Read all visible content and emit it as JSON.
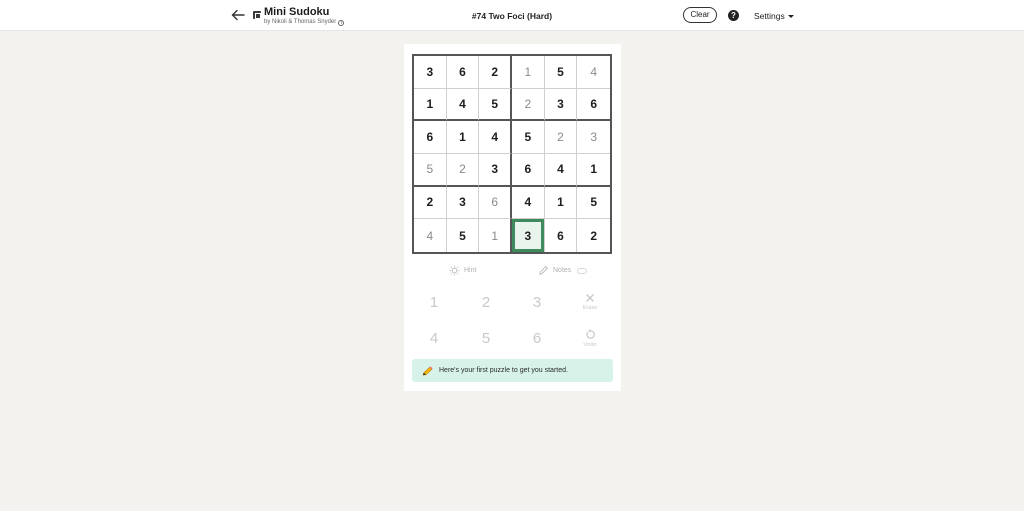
{
  "header": {
    "back_icon": "arrow-left-icon",
    "app_title": "Mini Sudoku",
    "byline": "by Nikoli & Thomas Snyder",
    "info_icon": "i",
    "puzzle_title": "#74 Two Foci (Hard)",
    "clear_label": "Clear",
    "help_label": "?",
    "settings_label": "Settings"
  },
  "grid": {
    "rows": [
      [
        {
          "v": "3",
          "given": true
        },
        {
          "v": "6",
          "given": true
        },
        {
          "v": "2",
          "given": true
        },
        {
          "v": "1",
          "given": false
        },
        {
          "v": "5",
          "given": true
        },
        {
          "v": "4",
          "given": false
        }
      ],
      [
        {
          "v": "1",
          "given": true
        },
        {
          "v": "4",
          "given": true
        },
        {
          "v": "5",
          "given": true
        },
        {
          "v": "2",
          "given": false
        },
        {
          "v": "3",
          "given": true
        },
        {
          "v": "6",
          "given": true
        }
      ],
      [
        {
          "v": "6",
          "given": true
        },
        {
          "v": "1",
          "given": true
        },
        {
          "v": "4",
          "given": true
        },
        {
          "v": "5",
          "given": true
        },
        {
          "v": "2",
          "given": false
        },
        {
          "v": "3",
          "given": false
        }
      ],
      [
        {
          "v": "5",
          "given": false
        },
        {
          "v": "2",
          "given": false
        },
        {
          "v": "3",
          "given": true
        },
        {
          "v": "6",
          "given": true
        },
        {
          "v": "4",
          "given": true
        },
        {
          "v": "1",
          "given": true
        }
      ],
      [
        {
          "v": "2",
          "given": true
        },
        {
          "v": "3",
          "given": true
        },
        {
          "v": "6",
          "given": false
        },
        {
          "v": "4",
          "given": true
        },
        {
          "v": "1",
          "given": true
        },
        {
          "v": "5",
          "given": true
        }
      ],
      [
        {
          "v": "4",
          "given": false
        },
        {
          "v": "5",
          "given": true
        },
        {
          "v": "1",
          "given": false
        },
        {
          "v": "3",
          "given": true
        },
        {
          "v": "6",
          "given": true
        },
        {
          "v": "2",
          "given": true
        }
      ]
    ],
    "selected": {
      "row": 5,
      "col": 3
    }
  },
  "tools": {
    "hint_label": "Hint",
    "notes_label": "Notes"
  },
  "keypad": {
    "numbers": [
      "1",
      "2",
      "3",
      "4",
      "5",
      "6"
    ],
    "erase_label": "Erase",
    "undo_label": "Undo"
  },
  "banner": {
    "text": "Here's your first puzzle to get you started."
  },
  "colors": {
    "selected_border": "#3f8a5c",
    "selected_fill": "#e9f5ec",
    "banner_bg": "#d7f3e9"
  }
}
